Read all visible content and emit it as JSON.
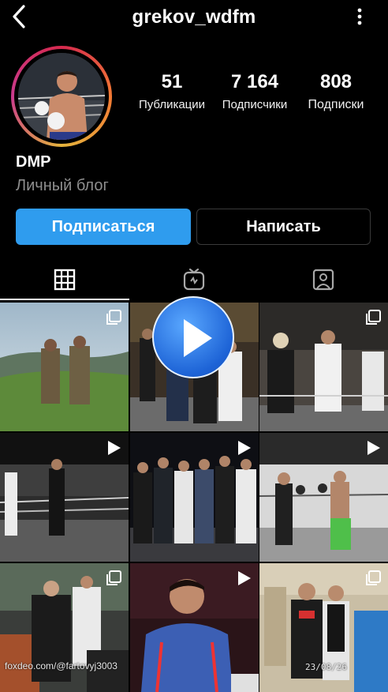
{
  "header": {
    "username": "grekov_wdfm"
  },
  "stats": [
    {
      "value": "51",
      "label": "Публикации"
    },
    {
      "value": "7 164",
      "label": "Подписчики"
    },
    {
      "value": "808",
      "label": "Подписки"
    }
  ],
  "bio": {
    "name": "DMP",
    "category": "Личный блог"
  },
  "actions": {
    "follow": "Подписаться",
    "message": "Написать"
  },
  "tabs": [
    "grid-icon",
    "igtv-icon",
    "tagged-icon"
  ],
  "posts": [
    {
      "id": 1,
      "badge": "carousel-icon"
    },
    {
      "id": 2,
      "badge": ""
    },
    {
      "id": 3,
      "badge": "carousel-icon"
    },
    {
      "id": 4,
      "badge": "video-icon"
    },
    {
      "id": 5,
      "badge": "video-icon"
    },
    {
      "id": 6,
      "badge": "video-icon"
    },
    {
      "id": 7,
      "badge": "carousel-icon"
    },
    {
      "id": 8,
      "badge": "video-icon"
    },
    {
      "id": 9,
      "badge": "carousel-icon"
    }
  ],
  "watermark": {
    "site": "foxdeo.com/@fartovyj3003",
    "date": "23/08/26"
  },
  "colors": {
    "follow_button": "#2f9cee",
    "background": "#000000",
    "secondary_text": "#8e8e8e"
  }
}
